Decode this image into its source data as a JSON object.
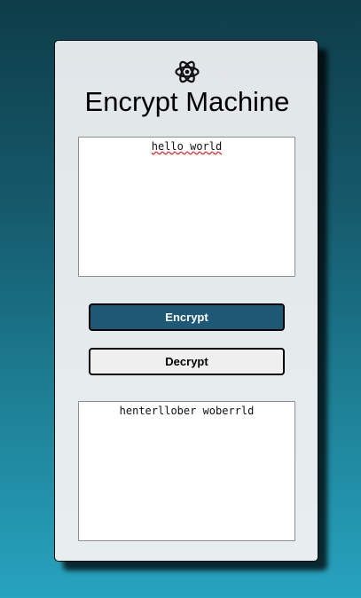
{
  "app": {
    "title": "Encrypt Machine",
    "logo_icon": "atom-icon"
  },
  "input": {
    "value": "hello world"
  },
  "buttons": {
    "encrypt_label": "Encrypt",
    "decrypt_label": "Decrypt"
  },
  "output": {
    "value": "henterllober woberrld"
  },
  "colors": {
    "background_top": "#0e3c48",
    "background_bottom": "#27a3bf",
    "encrypt_button": "#1d5874",
    "card": "#e4e9ec"
  }
}
